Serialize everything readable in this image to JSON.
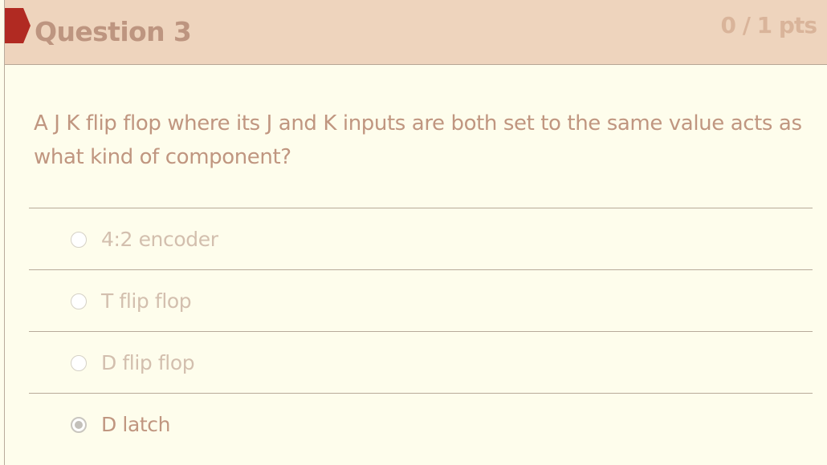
{
  "question": {
    "title": "Question 3",
    "points": "0 / 1 pts",
    "text": "A J K flip flop where its J and K inputs are both set to the same value acts as what kind of component?"
  },
  "answers": [
    {
      "label": "4:2 encoder",
      "selected": false
    },
    {
      "label": "T flip flop",
      "selected": false
    },
    {
      "label": "D flip flop",
      "selected": false
    },
    {
      "label": "D latch",
      "selected": true
    }
  ],
  "colors": {
    "header_bg": "#eed4bd",
    "page_bg": "#fefdec",
    "flag": "#b12a22",
    "title_text": "#bd9580",
    "points_text": "#d9b49a"
  }
}
